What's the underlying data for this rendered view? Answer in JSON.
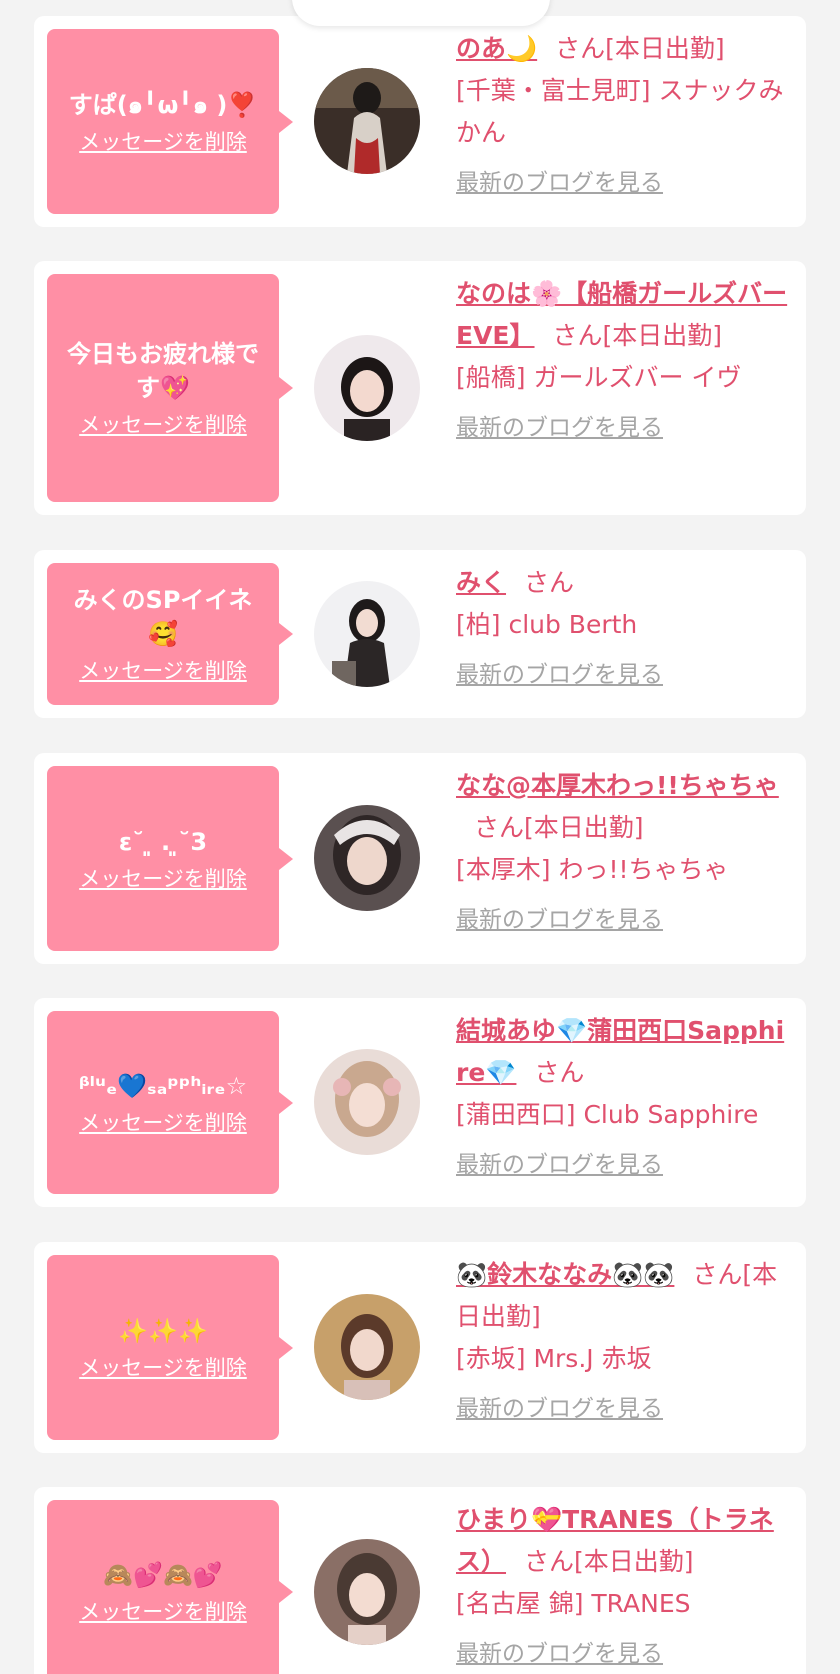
{
  "colors": {
    "accent": "#e0506e",
    "bubble": "#ff8fa5",
    "link_gray": "#a5a5a5",
    "background": "#f3f3f3"
  },
  "delete_label": "メッセージを削除",
  "blog_label": "最新のブログを見る",
  "san_label": "さん",
  "items": [
    {
      "message": "すぱ(๑╹ω╹๑ )❣️",
      "name": "のあ🌙",
      "status": "[本日出勤]",
      "shop": "[千葉・富士見町] スナックみかん"
    },
    {
      "message": "今日もお疲れ様です💖",
      "name": "なのは🌸【船橋ガールズバーEVE】",
      "status": "[本日出勤]",
      "shop": "[船橋] ガールズバー イヴ"
    },
    {
      "message": "みくのSPイイネ🥰",
      "name": "みく",
      "status": "",
      "shop": "[柏] club Berth"
    },
    {
      "message": "ε˘ ͈ .  ͈˘3",
      "name": "なな@本厚木わっ!!ちゃちゃ",
      "status": "[本日出勤]",
      "shop": "[本厚木] わっ!!ちゃちゃ"
    },
    {
      "message": "ᵝˡᵘₑ💙ₛₐᵖᵖʰᵢᵣₑ☆",
      "name": "結城あゆ💎蒲田西口Sapphire💎",
      "status": "",
      "shop": "[蒲田西口] Club Sapphire"
    },
    {
      "message": "✨✨✨",
      "name": "🐼鈴木ななみ🐼🐼",
      "status": "[本日出勤]",
      "shop": "[赤坂] Mrs.J 赤坂"
    },
    {
      "message": "🙈💕🙈💕",
      "name": "ひまり💝TRANES（トラネス）",
      "status": "[本日出勤]",
      "shop": "[名古屋 錦] TRANES"
    }
  ]
}
